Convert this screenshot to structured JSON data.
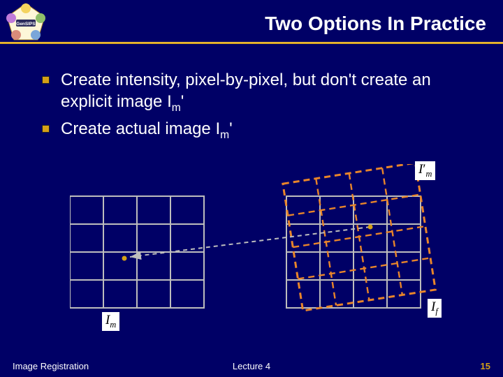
{
  "title": "Two Options In Practice",
  "bullets": {
    "b1_a": "Create intensity, pixel-by-pixel, but don't create an explicit image I",
    "b1_sub": "m",
    "b1_b": "'",
    "b2_a": "Create actual image I",
    "b2_sub": "m",
    "b2_b": "'"
  },
  "labels": {
    "Im": "I",
    "Im_sub": "m",
    "Imp": "I",
    "Imp_sub": "m",
    "Imp_prime": "′",
    "If": "I",
    "If_sub": "f"
  },
  "footer": {
    "left": "Image Registration",
    "center": "Lecture 4",
    "right": "15"
  }
}
